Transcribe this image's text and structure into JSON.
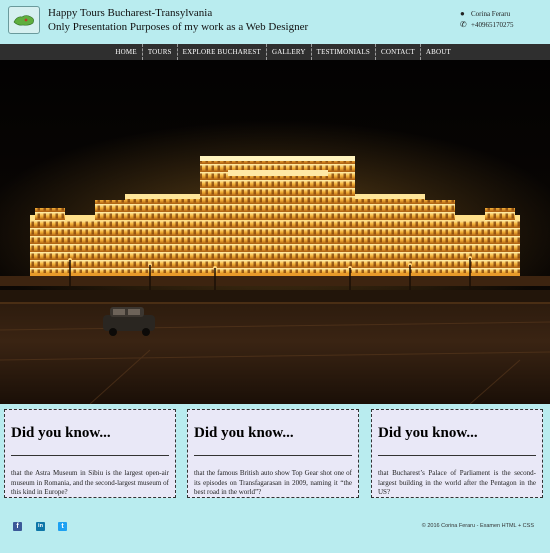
{
  "header": {
    "title": "Happy Tours Bucharest-Transylvania",
    "subtitle": "Only Presentation Purposes of my work as a Web Designer",
    "contact_name": "Corina Feraru",
    "contact_phone": "+40965170275",
    "person_icon": "user-icon",
    "phone_icon": "phone-icon"
  },
  "nav": {
    "items": [
      "HOME",
      "TOURS",
      "EXPLORE BUCHAREST",
      "GALLERY",
      "TESTIMONIALS",
      "CONTACT",
      "ABOUT"
    ]
  },
  "cards": [
    {
      "title": "Did you know...",
      "text": "that the Astra Museum in Sibiu is the largest open-air museum in Romania, and the second-largest museum of this kind in Europe?"
    },
    {
      "title": "Did you know...",
      "text": "that the famous British auto show Top Gear shot one of its episodes on Transfagarasan in 2009, naming it “the best road in the world”?"
    },
    {
      "title": "Did you know...",
      "text": "that Bucharest’s Palace of Parliament is the second-largest building in the world after the Pentagon in the US?"
    }
  ],
  "footer": {
    "social": [
      {
        "name": "facebook-icon",
        "glyph": "f",
        "color": "#3b5998"
      },
      {
        "name": "linkedin-icon",
        "glyph": "in",
        "color": "#0e76a8"
      },
      {
        "name": "twitter-icon",
        "glyph": "t",
        "color": "#1da1f2"
      }
    ],
    "copyright": "© 2016 Corina Feraru - Examen HTML + CSS"
  },
  "colors": {
    "page_bg": "#b9ecef",
    "nav_bg": "#2f2f2f",
    "card_bg": "#e9e8f7"
  }
}
